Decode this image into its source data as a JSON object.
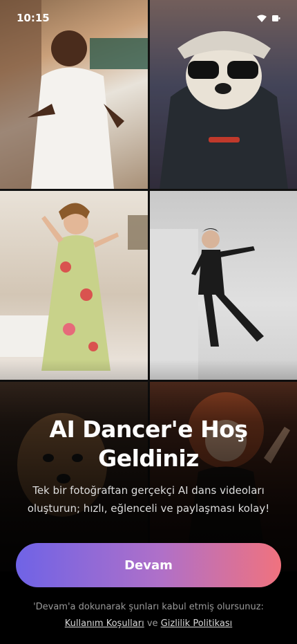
{
  "status_bar": {
    "time": "10:15",
    "icons": [
      "wifi-icon",
      "battery-icon"
    ]
  },
  "gallery": {
    "tiles": [
      {
        "name": "tile-man-dancing"
      },
      {
        "name": "tile-dog-sunglasses"
      },
      {
        "name": "tile-woman-floral-dress"
      },
      {
        "name": "tile-woman-black-outfit"
      },
      {
        "name": "tile-dog-portrait"
      },
      {
        "name": "tile-woman-red-hair"
      }
    ]
  },
  "welcome": {
    "title": "AI Dancer'e Hoş Geldiniz",
    "subtitle": "Tek bir fotoğraftan gerçekçi AI dans videoları oluşturun; hızlı, eğlenceli ve paylaşması kolay!"
  },
  "cta": {
    "label": "Devam"
  },
  "legal": {
    "prefix": "'Devam'a dokunarak şunları kabul etmiş olursunuz:",
    "terms": "Kullanım Koşulları",
    "and": "ve",
    "privacy": "Gizlilik Politikası"
  },
  "colors": {
    "cta_start": "#6f63e6",
    "cta_end": "#f0727e",
    "background": "#000000"
  }
}
